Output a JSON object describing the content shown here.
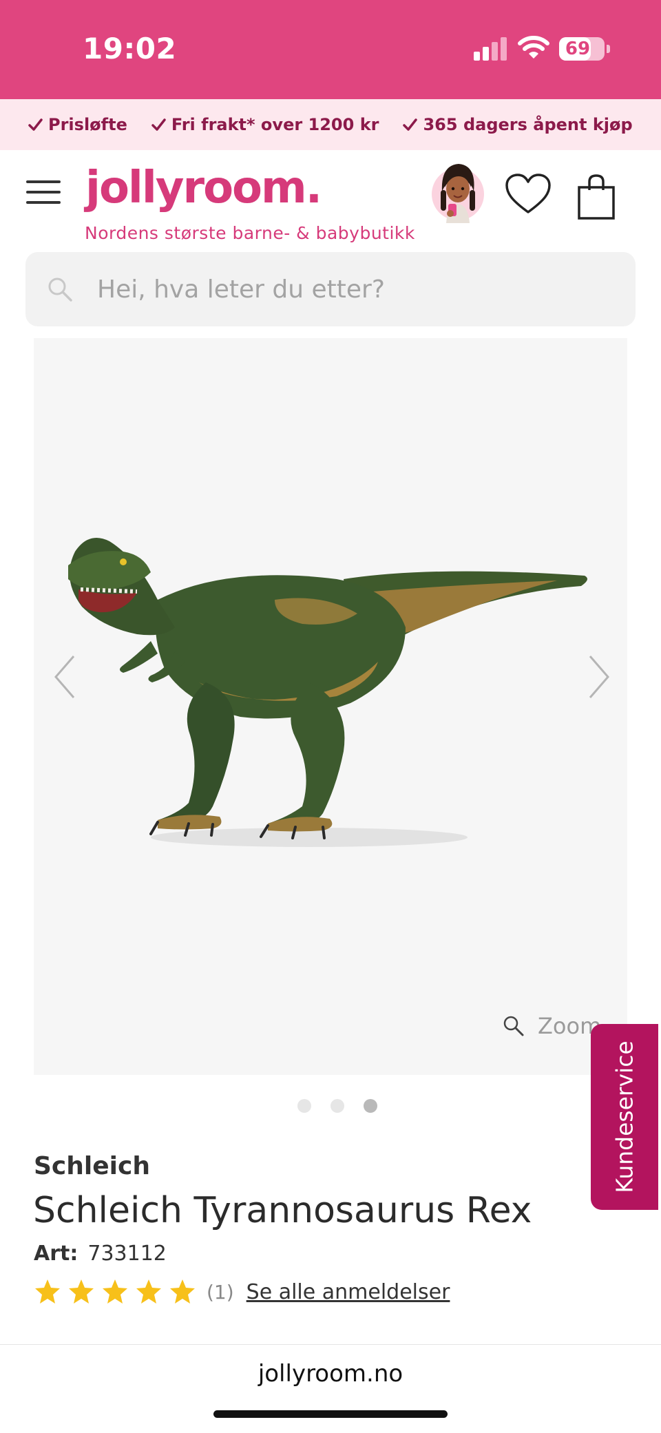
{
  "status_bar": {
    "time": "19:02",
    "battery": "69",
    "battery_level": 0.69,
    "icons": [
      "signal-icon",
      "wifi-icon",
      "battery-icon"
    ]
  },
  "usp": [
    {
      "label": "Prisløfte"
    },
    {
      "label": "Fri frakt* over 1200 kr"
    },
    {
      "label": "365 dagers åpent kjøp"
    }
  ],
  "header": {
    "logo": "jollyroom.",
    "tagline": "Nordens største barne- & babybutikk",
    "icons": [
      "menu-icon",
      "assistant-avatar",
      "heart-icon",
      "shopping-bag-icon"
    ]
  },
  "search": {
    "placeholder": "Hei, hva leter du etter?"
  },
  "gallery": {
    "zoom_label": "Zoom",
    "image_count": 3,
    "active_index": 2
  },
  "customer_service": {
    "label": "Kundeservice"
  },
  "product": {
    "brand": "Schleich",
    "title": "Schleich Tyrannosaurus Rex",
    "art_label": "Art:",
    "art_number": "733112",
    "rating": 5,
    "review_count": "(1)",
    "reviews_link": "Se alle anmeldelser"
  },
  "browser": {
    "url": "jollyroom.no"
  },
  "colors": {
    "brand_pink": "#e0457f",
    "usp_bg": "#fde8ee",
    "customer_service": "#b3145e",
    "star": "#f7c01a"
  }
}
